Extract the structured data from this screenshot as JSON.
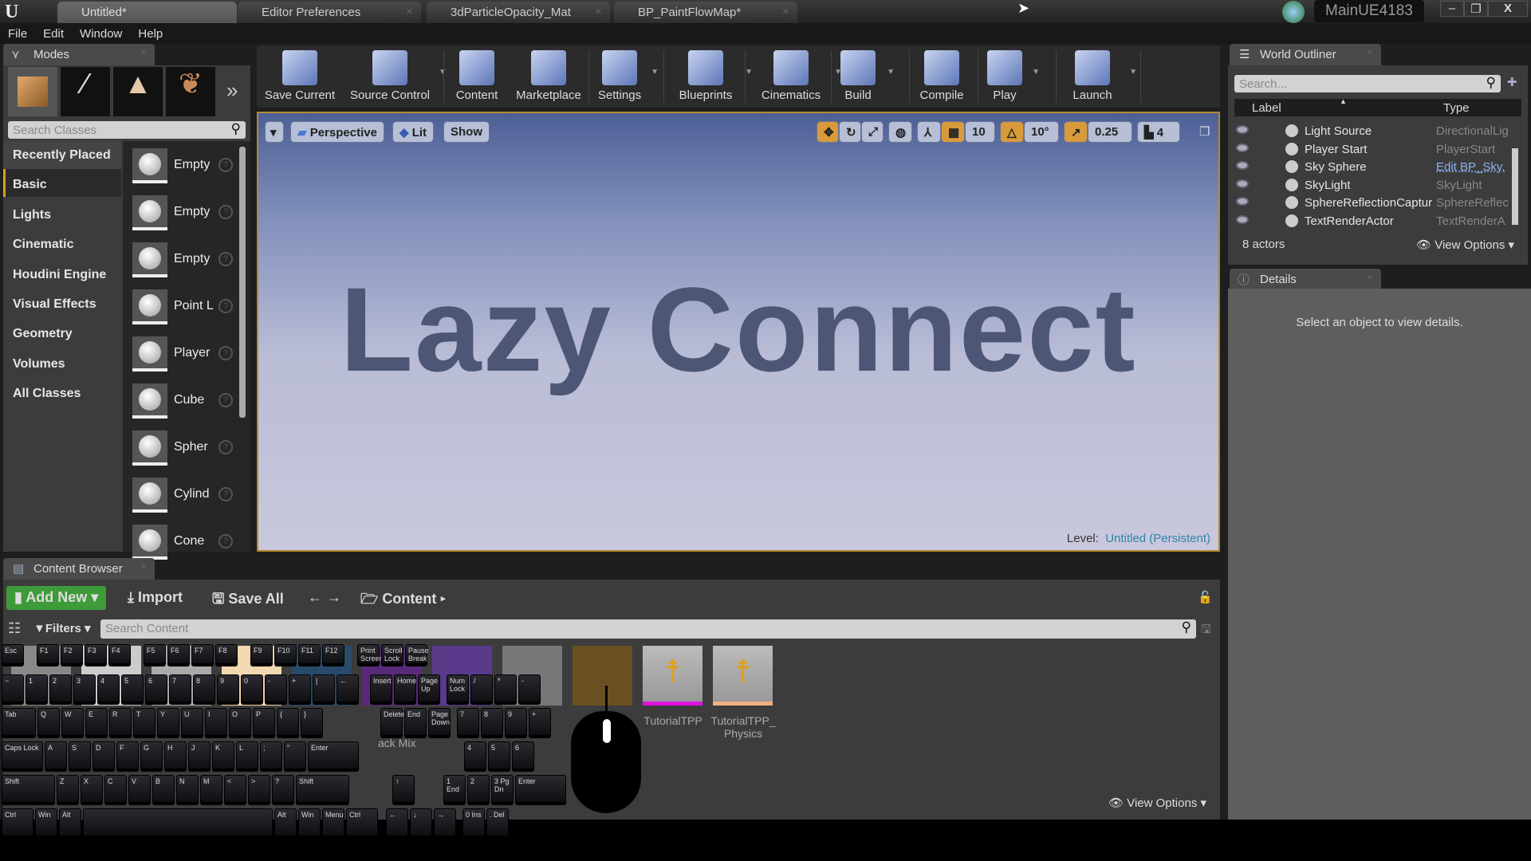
{
  "titlebar": {
    "tabs": [
      "Untitled*",
      "Editor Preferences",
      "3dParticleOpacity_Mat",
      "BP_PaintFlowMap*"
    ],
    "project": "MainUE4183",
    "window_buttons": [
      "minimize",
      "maximize",
      "close"
    ]
  },
  "menu": [
    "File",
    "Edit",
    "Window",
    "Help"
  ],
  "modes": {
    "tab": "Modes",
    "search_placeholder": "Search Classes",
    "categories": [
      "Recently Placed",
      "Basic",
      "Lights",
      "Cinematic",
      "Houdini Engine",
      "Visual Effects",
      "Geometry",
      "Volumes",
      "All Classes"
    ],
    "selected_category": "Basic",
    "items": [
      "Empty",
      "Empty",
      "Empty",
      "Point L",
      "Player",
      "Cube",
      "Spher",
      "Cylind",
      "Cone"
    ]
  },
  "toolbar": [
    "Save Current",
    "Source Control",
    "Content",
    "Marketplace",
    "Settings",
    "Blueprints",
    "Cinematics",
    "Build",
    "Compile",
    "Play",
    "Launch"
  ],
  "viewport": {
    "buttons": [
      "Perspective",
      "Lit",
      "Show"
    ],
    "grid": "10",
    "rotation": "10°",
    "scale": "0.25",
    "camera_speed": "4",
    "text": "Lazy Connect",
    "level_label": "Level:",
    "level_name": "Untitled (Persistent)"
  },
  "outliner": {
    "tab": "World Outliner",
    "search_placeholder": "Search...",
    "col_label": "Label",
    "col_type": "Type",
    "rows": [
      {
        "name": "Light Source",
        "type": "DirectionalLig"
      },
      {
        "name": "Player Start",
        "type": "PlayerStart"
      },
      {
        "name": "Sky Sphere",
        "type": "Edit BP_Sky."
      },
      {
        "name": "SkyLight",
        "type": "SkyLight"
      },
      {
        "name": "SphereReflectionCaptur",
        "type": "SphereReflec"
      },
      {
        "name": "TextRenderActor",
        "type": "TextRenderA"
      }
    ],
    "count": "8 actors",
    "view_options": "View Options"
  },
  "details": {
    "tab": "Details",
    "empty": "Select an object to view details."
  },
  "content_browser": {
    "tab": "Content Browser",
    "add_new": "Add New",
    "import": "Import",
    "save_all": "Save All",
    "path": "Content",
    "filters": "Filters",
    "search_placeholder": "Search Content",
    "partial_label": "ack  Mix",
    "assets": [
      {
        "name": "TutorialTPP",
        "color": "#e010e0"
      },
      {
        "name": "TutorialTPP_ Physics",
        "color": "#f0b080"
      }
    ],
    "view_options": "View Options"
  },
  "keyboard": {
    "rows": [
      [
        "Esc",
        "F1",
        "F2",
        "F3",
        "F4",
        "F5",
        "F6",
        "F7",
        "F8",
        "F9",
        "F10",
        "F11",
        "F12",
        "Print Screen",
        "Scroll Lock",
        "Pause Break"
      ],
      [
        "~",
        "1",
        "2",
        "3",
        "4",
        "5",
        "6",
        "7",
        "8",
        "9",
        "0",
        "-",
        "+",
        "|",
        "←",
        "Insert",
        "Home",
        "Page Up",
        "Num Lock",
        "/",
        "*",
        "-"
      ],
      [
        "Tab",
        "Q",
        "W",
        "E",
        "R",
        "T",
        "Y",
        "U",
        "I",
        "O",
        "P",
        "{",
        "}",
        "Delete",
        "End",
        "Page Down",
        "7",
        "8",
        "9",
        "+"
      ],
      [
        "Caps Lock",
        "A",
        "S",
        "D",
        "F",
        "G",
        "H",
        "J",
        "K",
        "L",
        ";",
        "\"",
        "Enter",
        "4",
        "5",
        "6"
      ],
      [
        "Shift",
        "Z",
        "X",
        "C",
        "V",
        "B",
        "N",
        "M",
        "<",
        ">",
        "?",
        "Shift",
        "↑",
        "1 End",
        "2",
        "3 Pg Dn",
        "Enter"
      ],
      [
        "Ctrl",
        "Win",
        "Alt",
        "",
        "Alt",
        "Win",
        "Menu",
        "Ctrl",
        "←",
        "↓",
        "→",
        "0 Ins",
        ". Del"
      ]
    ]
  }
}
